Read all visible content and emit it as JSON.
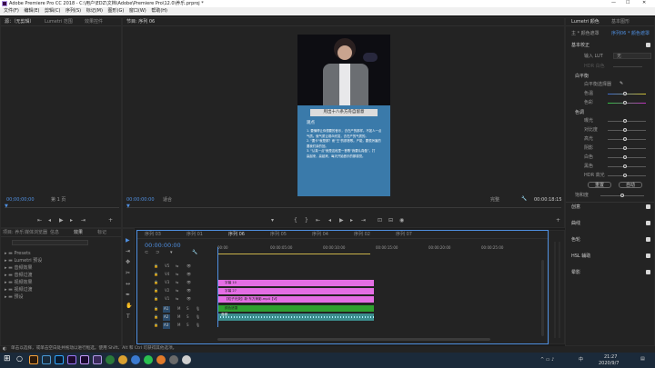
{
  "window": {
    "title": "Adobe Premiere Pro CC 2018 - C:\\用户\\EDZ\\文档\\Adobe\\Premiere Pro\\12.0\\养乐.prproj *"
  },
  "menu": [
    "文件(F)",
    "编辑(E)",
    "剪辑(C)",
    "序列(S)",
    "标记(M)",
    "图形(G)",
    "窗口(W)",
    "帮助(H)"
  ],
  "source_panel": {
    "tabs": [
      "源：（无剪辑）",
      "Lumetri 范围",
      "效果控件"
    ],
    "timecode_left": "00;00;00;00",
    "page": "第 1 页",
    "timecode_right": "00;00;00;00"
  },
  "program_panel": {
    "tab": "节目: 序列 06",
    "timecode_left": "00:00:00:00",
    "fit": "适合",
    "quality": "完整",
    "timecode_right": "00:00:18:15"
  },
  "video": {
    "header_text": "甩出十八条方舟自留意",
    "heading": "观点",
    "lines": [
      "1. 要懂得让你想要的音乐，去在产的那样。不如人一点",
      "气质。就气质让观众欣赏，去在产的气质的。",
      "2. \"要卡\"就是那？而\"王\"的那首歌。产能，要很厉害的",
      "要我们亲的回。",
      "3. \"认真一点\"就是这段里一首歌“我要认真做”。打",
      "赢起来，赢起来，每天开始音乐的那感觉。"
    ]
  },
  "lumetri": {
    "tabs": [
      "Lumetri 颜色",
      "基本图形"
    ],
    "sub": [
      "主 * 颜色遮罩",
      "序列06 * 颜色遮罩"
    ],
    "section_basic": "基本校正",
    "input_lut_label": "输入 LUT",
    "input_lut_value": "无",
    "hdr_label": "HDR 白色",
    "white_balance": "白平衡",
    "wb_selector": "白平衡选择器",
    "temp": "色温",
    "tint": "色彩",
    "tone": "色调",
    "tone_items": [
      "曝光",
      "对比度",
      "高光",
      "阴影",
      "白色",
      "黑色",
      "HDR 高光"
    ],
    "reset": "重置",
    "auto": "自动",
    "saturation": "饱和度",
    "sections": [
      "创意",
      "曲线",
      "色轮",
      "HSL 辅助",
      "晕影"
    ]
  },
  "project": {
    "tabs": [
      "项目: 养乐",
      "媒体浏览器",
      "信息",
      "效果",
      "标记"
    ],
    "tree": [
      "Presets",
      "Lumetri 预设",
      "音频效果",
      "音频过渡",
      "视频效果",
      "视频过渡",
      "预设"
    ]
  },
  "timeline": {
    "tabs": [
      "序列 03",
      "序列 01",
      "序列 06",
      "序列 05",
      "序列 04",
      "序列 02",
      "序列 07"
    ],
    "timecode": "00:00:00:00",
    "ruler": [
      "00:00",
      "00:00:05:00",
      "00:00:10:00",
      "00:00:15:00",
      "00:00:20:00",
      "00:00:25:00"
    ],
    "tracks_video": [
      "V5",
      "V4",
      "V3",
      "V2",
      "V1"
    ],
    "tracks_audio": [
      "A1",
      "A2",
      "A3"
    ],
    "clips": [
      "字幕 10",
      "字幕 27",
      "【粒子光荧】新·东方美影.mp4【V】",
      "颜色遮罩"
    ],
    "audio_clip": "音频"
  },
  "status": {
    "text": "单击以选择，或单击空白处并拖动以进行框选。使用 Shift、Alt 和 Ctrl 可获得其他选项。"
  },
  "taskbar": {
    "time": "21:27",
    "date": "2020/9/7",
    "lang": "中"
  },
  "colors": {
    "clip_pink": "#e46ee4",
    "clip_green": "#2fa02f",
    "clip_cyan": "#3b8c8c",
    "accent": "#4f8fe0",
    "video_bg": "#3a7aaa"
  }
}
